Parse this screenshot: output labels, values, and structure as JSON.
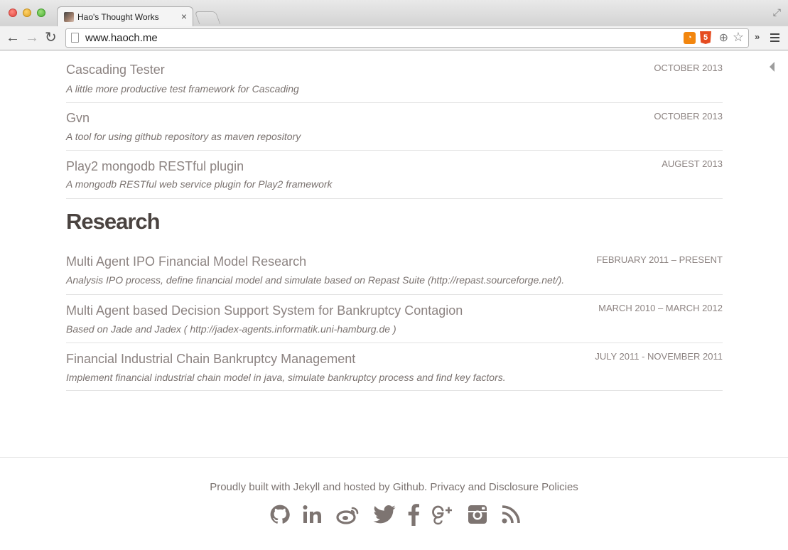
{
  "browser": {
    "tab_title": "Hao's Thought Works",
    "tab_close": "×",
    "url": "www.haoch.me",
    "overflow": "»"
  },
  "projects": [
    {
      "title": "Cascading Tester",
      "description": "A little more productive test framework for Cascading",
      "date": "OCTOBER 2013"
    },
    {
      "title": "Gvn",
      "description": "A tool for using github repository as maven repository",
      "date": "OCTOBER 2013"
    },
    {
      "title": "Play2 mongodb RESTful plugin",
      "description": "A mongodb RESTful web service plugin for Play2 framework",
      "date": "AUGEST 2013"
    }
  ],
  "research": {
    "heading": "Research",
    "items": [
      {
        "title": "Multi Agent IPO Financial Model Research",
        "description": "Analysis IPO process, define financial model and simulate based on Repast Suite (http://repast.sourceforge.net/).",
        "date": "FEBRUARY 2011 – PRESENT"
      },
      {
        "title": "Multi Agent based Decision Support System for Bankruptcy Contagion",
        "description": "Based on Jade and Jadex ( http://jadex-agents.informatik.uni-hamburg.de )",
        "date": "MARCH 2010 – MARCH 2012"
      },
      {
        "title": "Financial Industrial Chain Bankruptcy Management",
        "description": "Implement financial industrial chain model in java, simulate bankruptcy process and find key factors.",
        "date": "JULY 2011 - NOVEMBER 2011"
      }
    ]
  },
  "footer": {
    "text": "Proudly built with Jekyll and hosted by Github. Privacy and Disclosure Policies",
    "social_icons": [
      "github-icon",
      "linkedin-icon",
      "weibo-icon",
      "twitter-icon",
      "facebook-icon",
      "google-plus-icon",
      "instagram-icon",
      "rss-icon"
    ]
  },
  "colors": {
    "text_muted": "#8c8381",
    "heading": "#4a4340",
    "icon": "#7d7471"
  }
}
